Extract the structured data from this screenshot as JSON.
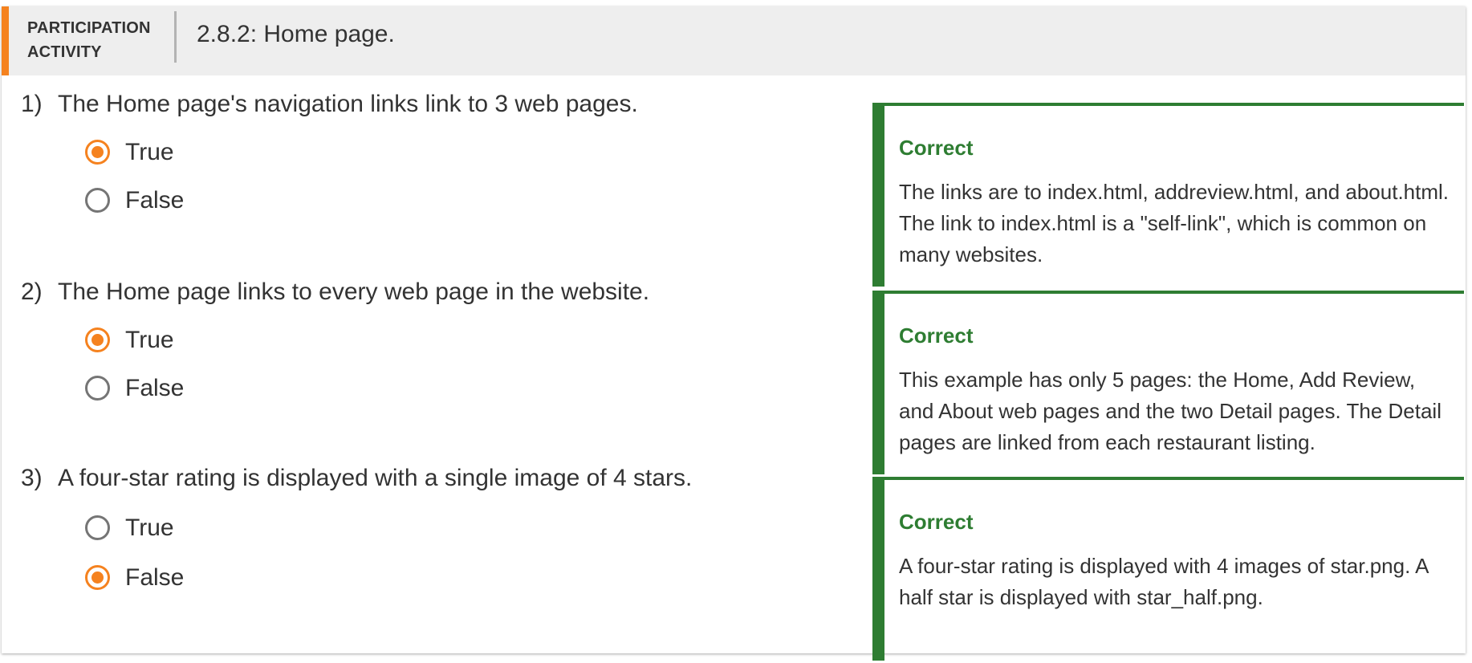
{
  "activity": {
    "label_line1": "PARTICIPATION",
    "label_line2": "ACTIVITY",
    "title": "2.8.2: Home page."
  },
  "colors": {
    "accent": "#f5821f",
    "correct": "#2e7d32",
    "header_bg": "#eeeeee"
  },
  "questions": [
    {
      "number": "1)",
      "text": "The Home page's navigation links link to 3 web pages.",
      "options": [
        {
          "label": "True",
          "selected": true
        },
        {
          "label": "False",
          "selected": false
        }
      ],
      "feedback": {
        "title": "Correct",
        "text": "The links are to index.html, addreview.html, and about.html. The link to index.html is a \"self-link\", which is common on many websites."
      }
    },
    {
      "number": "2)",
      "text": "The Home page links to every web page in the website.",
      "options": [
        {
          "label": "True",
          "selected": true
        },
        {
          "label": "False",
          "selected": false
        }
      ],
      "feedback": {
        "title": "Correct",
        "text": "This example has only 5 pages: the Home, Add Review, and About web pages and the two Detail pages. The Detail pages are linked from each restaurant listing."
      }
    },
    {
      "number": "3)",
      "text": "A four-star rating is displayed with a single image of 4 stars.",
      "options": [
        {
          "label": "True",
          "selected": false
        },
        {
          "label": "False",
          "selected": true
        }
      ],
      "feedback": {
        "title": "Correct",
        "text": "A four-star rating is displayed with 4 images of star.png. A half star is displayed with star_half.png."
      }
    }
  ]
}
